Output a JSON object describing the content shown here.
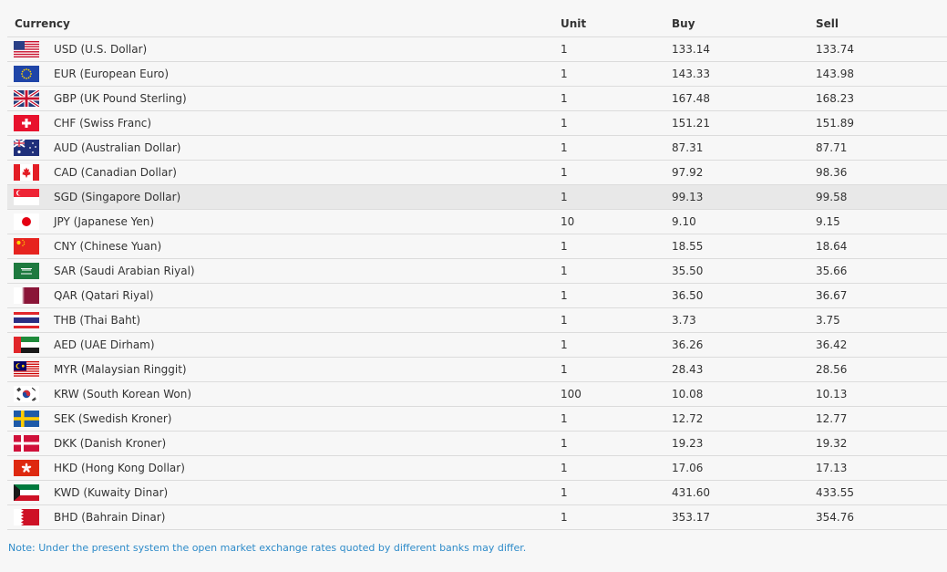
{
  "table": {
    "headers": {
      "currency": "Currency",
      "unit": "Unit",
      "buy": "Buy",
      "sell": "Sell"
    },
    "rows": [
      {
        "currency": "USD (U.S. Dollar)",
        "flag": "us-flag-icon",
        "unit": "1",
        "buy": "133.14",
        "sell": "133.74"
      },
      {
        "currency": "EUR (European Euro)",
        "flag": "eu-flag-icon",
        "unit": "1",
        "buy": "143.33",
        "sell": "143.98"
      },
      {
        "currency": "GBP (UK Pound Sterling)",
        "flag": "uk-flag-icon",
        "unit": "1",
        "buy": "167.48",
        "sell": "168.23"
      },
      {
        "currency": "CHF (Swiss Franc)",
        "flag": "switzerland-flag-icon",
        "unit": "1",
        "buy": "151.21",
        "sell": "151.89"
      },
      {
        "currency": "AUD (Australian Dollar)",
        "flag": "australia-flag-icon",
        "unit": "1",
        "buy": "87.31",
        "sell": "87.71"
      },
      {
        "currency": "CAD (Canadian Dollar)",
        "flag": "canada-flag-icon",
        "unit": "1",
        "buy": "97.92",
        "sell": "98.36"
      },
      {
        "currency": "SGD (Singapore Dollar)",
        "flag": "singapore-flag-icon",
        "unit": "1",
        "buy": "99.13",
        "sell": "99.58"
      },
      {
        "currency": "JPY (Japanese Yen)",
        "flag": "japan-flag-icon",
        "unit": "10",
        "buy": "9.10",
        "sell": "9.15"
      },
      {
        "currency": "CNY (Chinese Yuan)",
        "flag": "china-flag-icon",
        "unit": "1",
        "buy": "18.55",
        "sell": "18.64"
      },
      {
        "currency": "SAR (Saudi Arabian Riyal)",
        "flag": "saudi-arabia-flag-icon",
        "unit": "1",
        "buy": "35.50",
        "sell": "35.66"
      },
      {
        "currency": "QAR (Qatari Riyal)",
        "flag": "qatar-flag-icon",
        "unit": "1",
        "buy": "36.50",
        "sell": "36.67"
      },
      {
        "currency": "THB (Thai Baht)",
        "flag": "thailand-flag-icon",
        "unit": "1",
        "buy": "3.73",
        "sell": "3.75"
      },
      {
        "currency": "AED (UAE Dirham)",
        "flag": "uae-flag-icon",
        "unit": "1",
        "buy": "36.26",
        "sell": "36.42"
      },
      {
        "currency": "MYR (Malaysian Ringgit)",
        "flag": "malaysia-flag-icon",
        "unit": "1",
        "buy": "28.43",
        "sell": "28.56"
      },
      {
        "currency": "KRW (South Korean Won)",
        "flag": "south-korea-flag-icon",
        "unit": "100",
        "buy": "10.08",
        "sell": "10.13"
      },
      {
        "currency": "SEK (Swedish Kroner)",
        "flag": "sweden-flag-icon",
        "unit": "1",
        "buy": "12.72",
        "sell": "12.77"
      },
      {
        "currency": "DKK (Danish Kroner)",
        "flag": "denmark-flag-icon",
        "unit": "1",
        "buy": "19.23",
        "sell": "19.32"
      },
      {
        "currency": "HKD (Hong Kong Dollar)",
        "flag": "hong-kong-flag-icon",
        "unit": "1",
        "buy": "17.06",
        "sell": "17.13"
      },
      {
        "currency": "KWD (Kuwaity Dinar)",
        "flag": "kuwait-flag-icon",
        "unit": "1",
        "buy": "431.60",
        "sell": "433.55"
      },
      {
        "currency": "BHD (Bahrain Dinar)",
        "flag": "bahrain-flag-icon",
        "unit": "1",
        "buy": "353.17",
        "sell": "354.76"
      }
    ],
    "highlighted_row": "SGD (Singapore Dollar)"
  },
  "note": "Note: Under the present system the open market exchange rates quoted by different banks may differ.",
  "colors": {
    "note": "#2e8bc9",
    "row_highlight": "#e8e8e8",
    "divider": "#dcdcdc"
  }
}
